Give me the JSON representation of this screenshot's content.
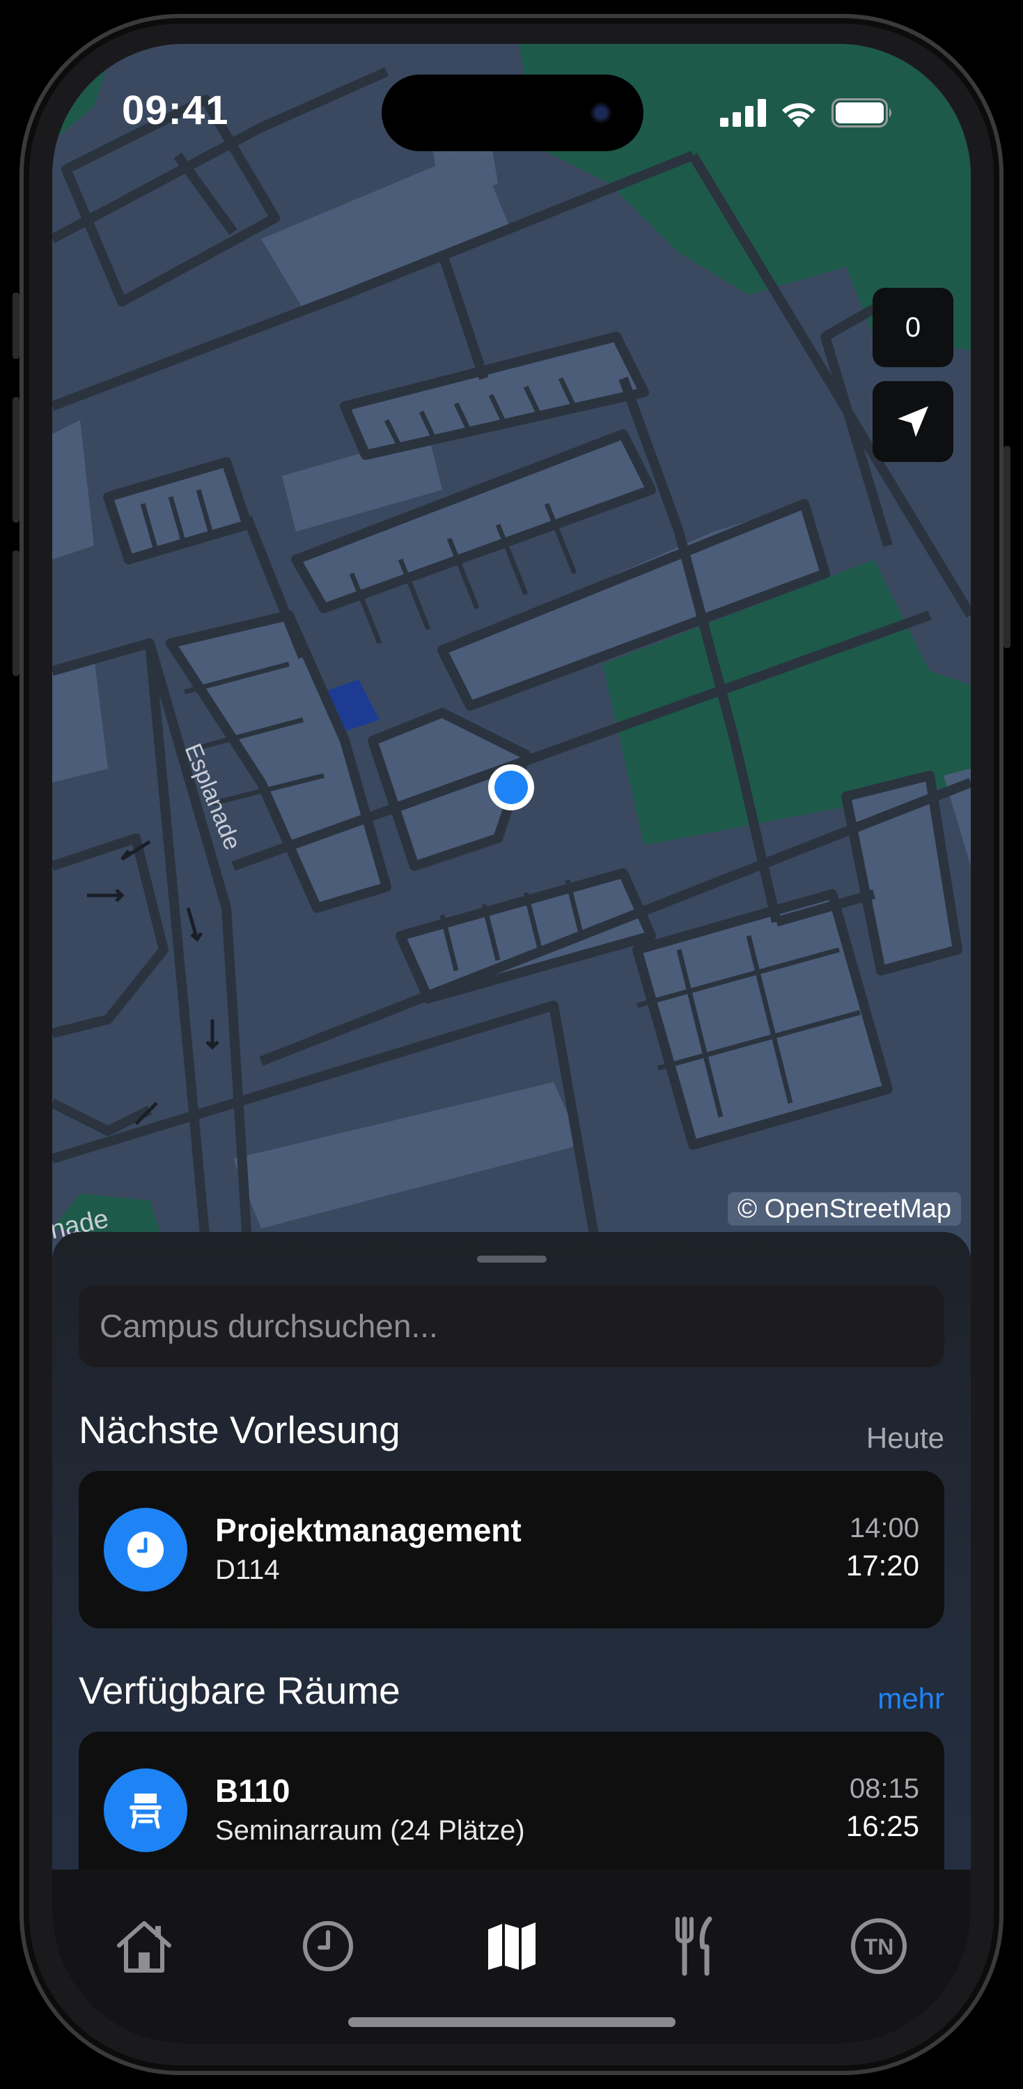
{
  "status_bar": {
    "time": "09:41"
  },
  "map": {
    "street_labels": [
      "Esplanade",
      "nade"
    ],
    "attribution": "© OpenStreetMap",
    "counter_badge": "0",
    "colors": {
      "background": "#3a4960",
      "building": "#4b5d79",
      "road": "#2b333f",
      "park": "#1e5a4a",
      "highlight": "#1d3b93",
      "user_location": "#1e84f5"
    }
  },
  "sheet": {
    "search_placeholder": "Campus durchsuchen...",
    "next_lecture": {
      "title": "Nächste Vorlesung",
      "aside": "Heute",
      "card": {
        "icon": "clock-icon",
        "name": "Projektmanagement",
        "room": "D114",
        "start": "14:00",
        "end": "17:20"
      }
    },
    "available_rooms": {
      "title": "Verfügbare Räume",
      "aside": "mehr",
      "card": {
        "icon": "desk-chair-icon",
        "name": "B110",
        "description": "Seminarraum (24 Plätze)",
        "start": "08:15",
        "end": "16:25"
      }
    }
  },
  "tabbar": {
    "tabs": [
      {
        "icon": "house-icon"
      },
      {
        "icon": "clock-icon"
      },
      {
        "icon": "map-icon",
        "selected": true
      },
      {
        "icon": "fork-knife-icon"
      },
      {
        "icon": "avatar-initials-icon",
        "initials": "TN"
      }
    ]
  },
  "accent_color": "#1e84f5"
}
